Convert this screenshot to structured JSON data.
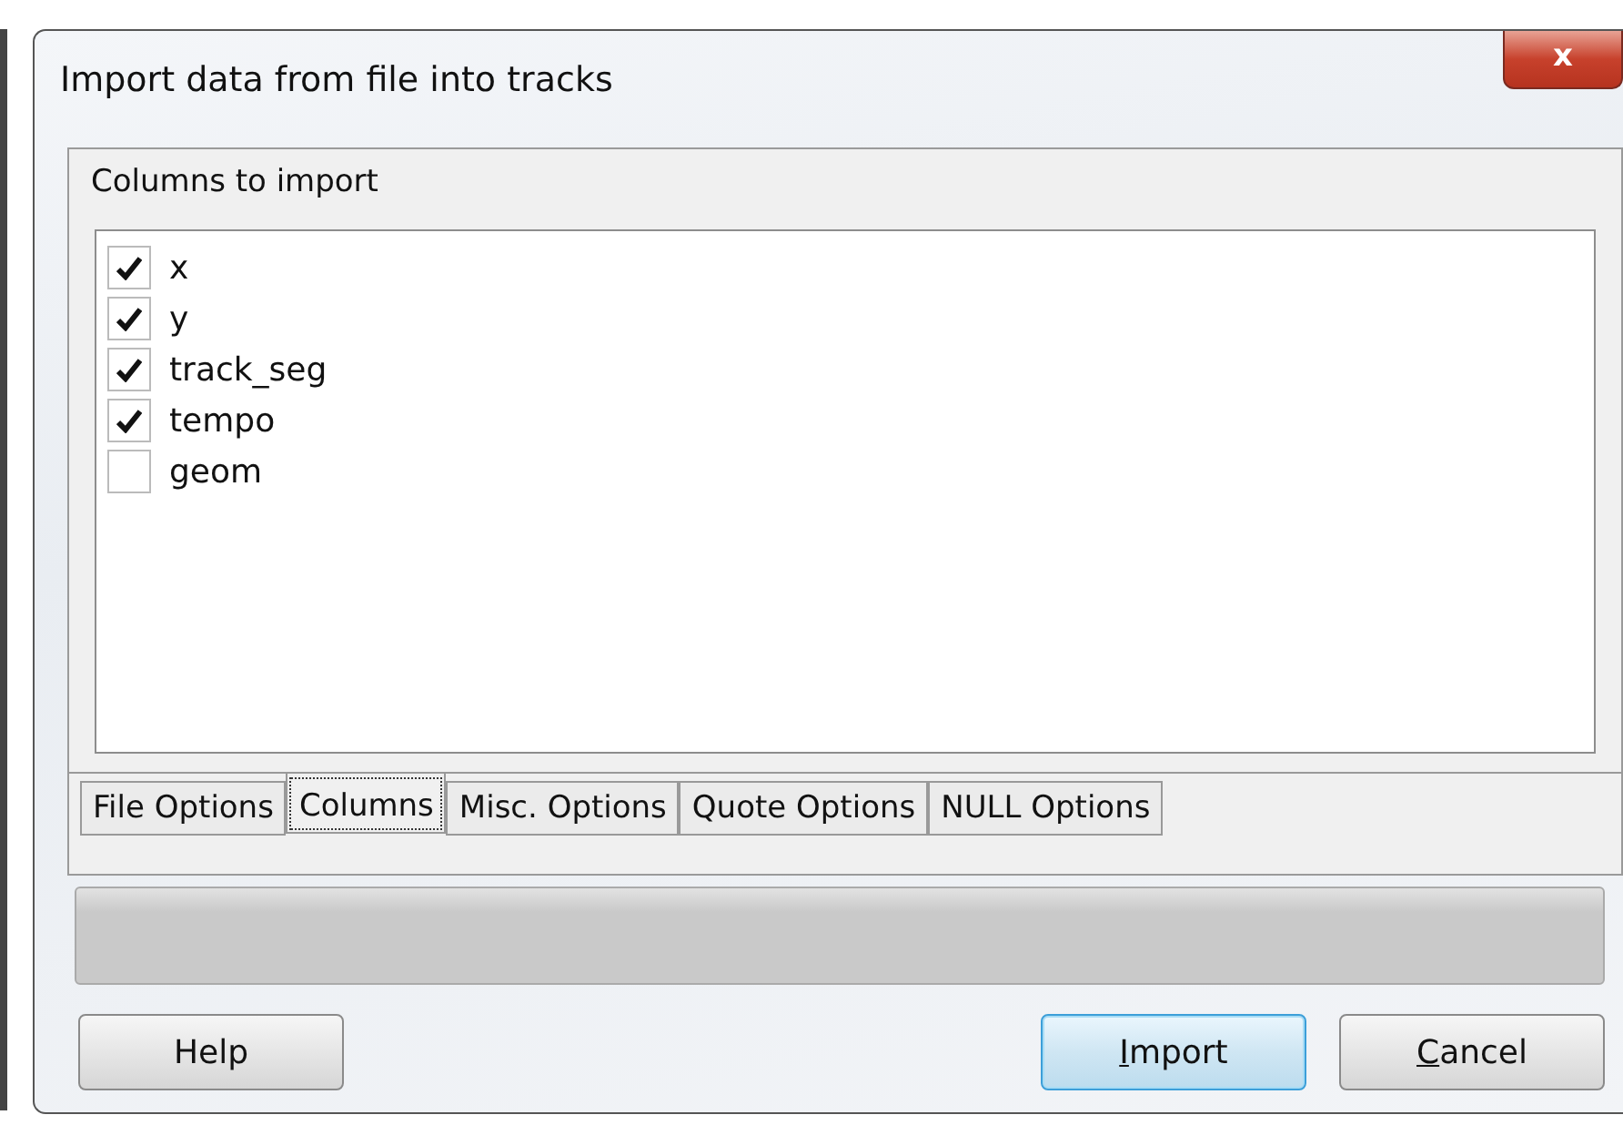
{
  "window": {
    "title": "Import data from file into tracks",
    "close_label": "x"
  },
  "group": {
    "label": "Columns to import"
  },
  "columns": [
    {
      "name": "x",
      "checked": true
    },
    {
      "name": "y",
      "checked": true
    },
    {
      "name": "track_seg",
      "checked": true
    },
    {
      "name": "tempo",
      "checked": true
    },
    {
      "name": "geom",
      "checked": false
    }
  ],
  "tabs": [
    {
      "label": "File Options",
      "selected": false
    },
    {
      "label": "Columns",
      "selected": true
    },
    {
      "label": "Misc. Options",
      "selected": false
    },
    {
      "label": "Quote Options",
      "selected": false
    },
    {
      "label": "NULL Options",
      "selected": false
    }
  ],
  "progress": {
    "level": 0
  },
  "buttons": [
    {
      "label": "Help",
      "default": false,
      "mnemonic": false
    },
    {
      "label": "Import",
      "default": true,
      "mnemonic": true
    },
    {
      "label": "Cancel",
      "default": false,
      "mnemonic": true
    }
  ]
}
